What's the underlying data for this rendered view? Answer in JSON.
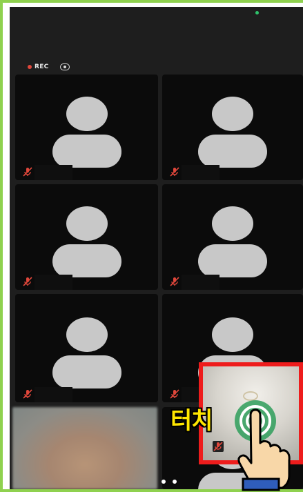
{
  "recording": {
    "label": "REC"
  },
  "tiles": [
    {
      "id": 1,
      "muted": true
    },
    {
      "id": 2,
      "muted": true
    },
    {
      "id": 3,
      "muted": true
    },
    {
      "id": 4,
      "muted": true
    },
    {
      "id": 5,
      "muted": true
    },
    {
      "id": 6,
      "muted": true
    }
  ],
  "annotation": {
    "touch_text": "터치",
    "highlight_color": "#ee1c1c",
    "text_color": "#ffe600"
  },
  "colors": {
    "frame": "#8fd14f",
    "background": "#1e1e1e",
    "tile": "#0b0b0b",
    "avatar": "#c8c8c8",
    "mute": "#e0473b"
  },
  "pager": {
    "pages": 2
  }
}
